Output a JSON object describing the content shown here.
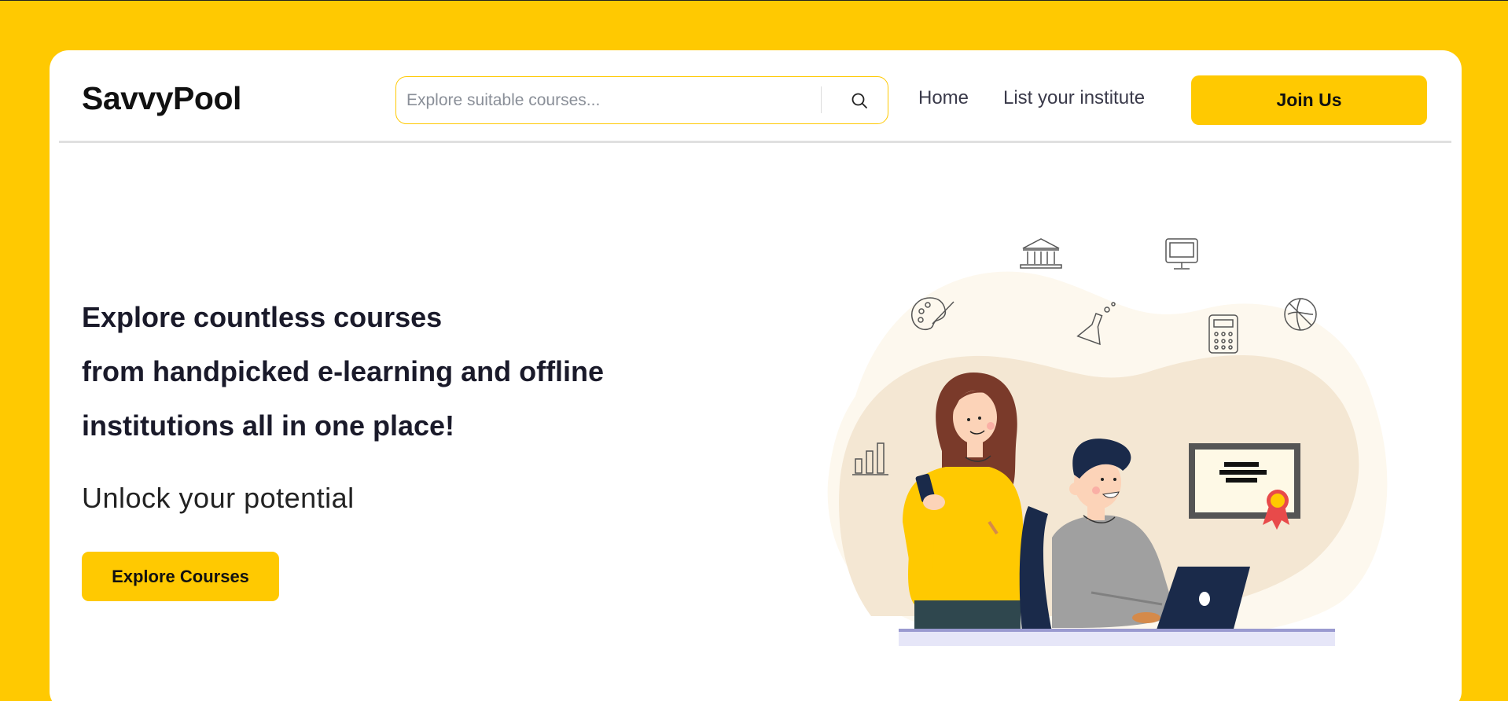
{
  "brand": {
    "logo_text": "SavvyPool"
  },
  "search": {
    "placeholder": "Explore suitable courses..."
  },
  "nav": {
    "home_label": "Home",
    "list_institute_label": "List your institute",
    "join_label": "Join Us"
  },
  "hero": {
    "title_lines": [
      "Explore countless courses",
      "from handpicked e-learning and offline",
      "institutions all in one place!"
    ],
    "subtitle": "Unlock your potential",
    "cta_label": "Explore Courses"
  },
  "icons": [
    "search-icon",
    "bank-icon",
    "monitor-icon",
    "palette-icon",
    "flask-icon",
    "calculator-icon",
    "basketball-icon",
    "bar-chart-icon",
    "certificate-icon"
  ],
  "colors": {
    "accent": "#ffc901",
    "text_dark": "#1a1a2a",
    "nav_text": "#3a3a4a"
  }
}
